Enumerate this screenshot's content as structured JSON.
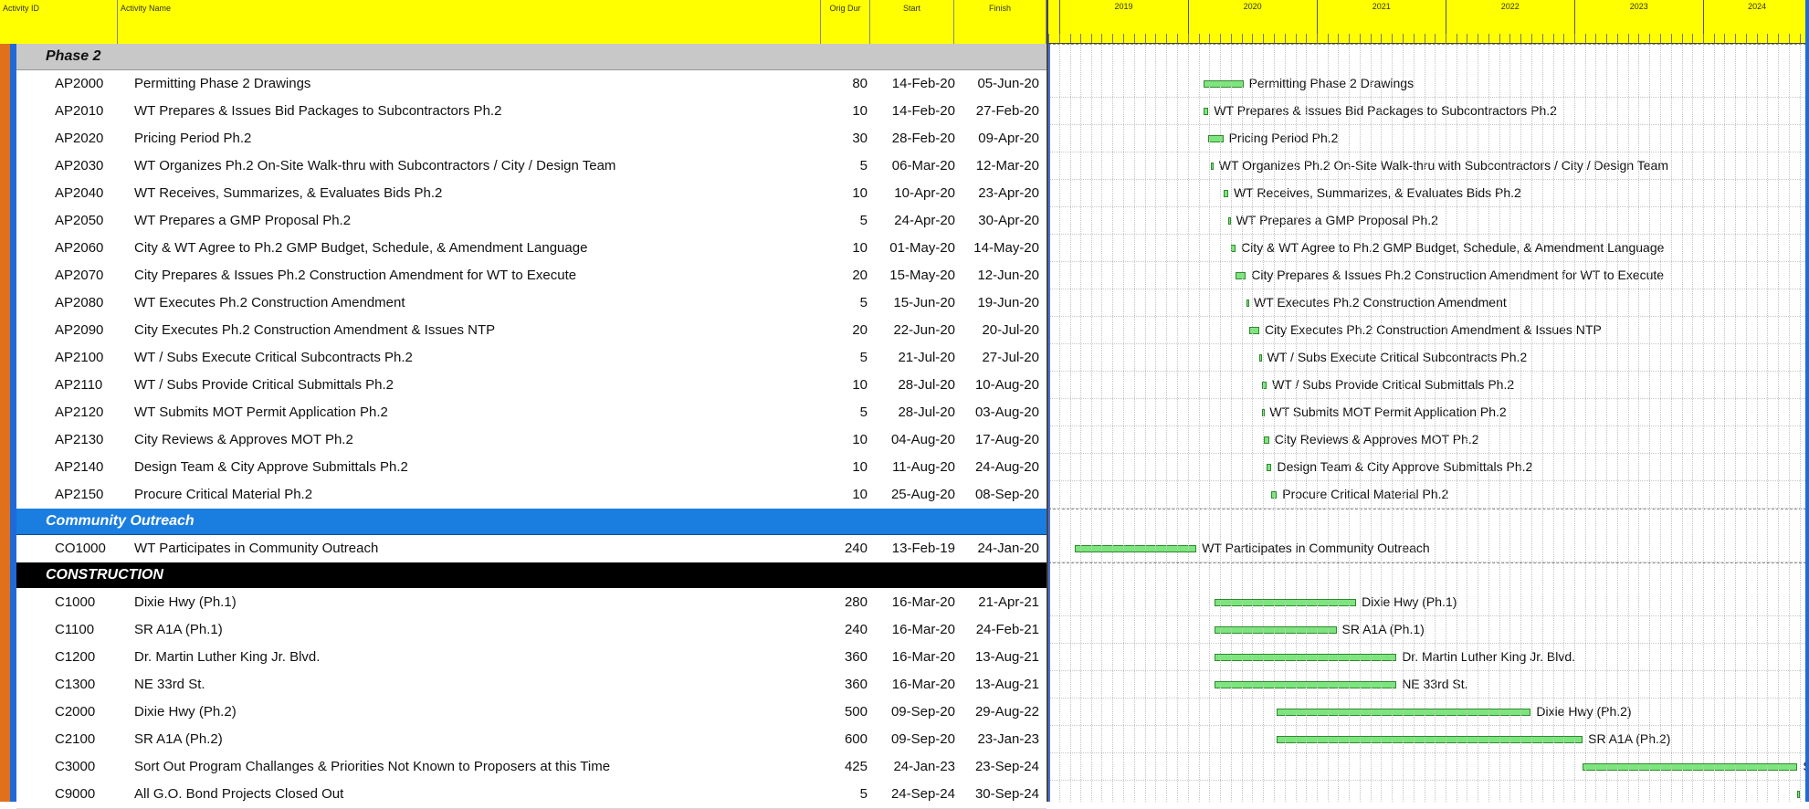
{
  "header": {
    "activity_id": "Activity ID",
    "activity_name": "Activity Name",
    "orig_dur": "Orig Dur",
    "start": "Start",
    "finish": "Finish",
    "years": [
      "2019",
      "2020",
      "2021",
      "2022",
      "2023",
      "2024"
    ]
  },
  "sections": [
    {
      "name": "Phase 2",
      "style": "gray",
      "rows": [
        {
          "id": "AP2000",
          "name": "Permitting Phase 2 Drawings",
          "dur": "80",
          "start": "14-Feb-20",
          "finish": "05-Jun-20"
        },
        {
          "id": "AP2010",
          "name": "WT Prepares & Issues Bid Packages to Subcontractors Ph.2",
          "dur": "10",
          "start": "14-Feb-20",
          "finish": "27-Feb-20"
        },
        {
          "id": "AP2020",
          "name": "Pricing Period Ph.2",
          "dur": "30",
          "start": "28-Feb-20",
          "finish": "09-Apr-20"
        },
        {
          "id": "AP2030",
          "name": "WT Organizes Ph.2 On-Site Walk-thru with Subcontractors / City / Design Team",
          "dur": "5",
          "start": "06-Mar-20",
          "finish": "12-Mar-20"
        },
        {
          "id": "AP2040",
          "name": "WT Receives, Summarizes, & Evaluates Bids Ph.2",
          "dur": "10",
          "start": "10-Apr-20",
          "finish": "23-Apr-20"
        },
        {
          "id": "AP2050",
          "name": "WT Prepares a GMP Proposal Ph.2",
          "dur": "5",
          "start": "24-Apr-20",
          "finish": "30-Apr-20"
        },
        {
          "id": "AP2060",
          "name": "City & WT Agree to Ph.2 GMP Budget, Schedule, & Amendment Language",
          "dur": "10",
          "start": "01-May-20",
          "finish": "14-May-20"
        },
        {
          "id": "AP2070",
          "name": "City Prepares & Issues Ph.2 Construction Amendment for WT to Execute",
          "dur": "20",
          "start": "15-May-20",
          "finish": "12-Jun-20"
        },
        {
          "id": "AP2080",
          "name": "WT Executes Ph.2 Construction Amendment",
          "dur": "5",
          "start": "15-Jun-20",
          "finish": "19-Jun-20"
        },
        {
          "id": "AP2090",
          "name": "City Executes Ph.2 Construction Amendment & Issues NTP",
          "dur": "20",
          "start": "22-Jun-20",
          "finish": "20-Jul-20"
        },
        {
          "id": "AP2100",
          "name": "WT / Subs Execute Critical Subcontracts Ph.2",
          "dur": "5",
          "start": "21-Jul-20",
          "finish": "27-Jul-20"
        },
        {
          "id": "AP2110",
          "name": "WT / Subs Provide Critical Submittals Ph.2",
          "dur": "10",
          "start": "28-Jul-20",
          "finish": "10-Aug-20"
        },
        {
          "id": "AP2120",
          "name": "WT Submits MOT Permit Application Ph.2",
          "dur": "5",
          "start": "28-Jul-20",
          "finish": "03-Aug-20"
        },
        {
          "id": "AP2130",
          "name": "City Reviews & Approves MOT Ph.2",
          "dur": "10",
          "start": "04-Aug-20",
          "finish": "17-Aug-20"
        },
        {
          "id": "AP2140",
          "name": "Design Team & City Approve Submittals Ph.2",
          "dur": "10",
          "start": "11-Aug-20",
          "finish": "24-Aug-20"
        },
        {
          "id": "AP2150",
          "name": "Procure Critical Material Ph.2",
          "dur": "10",
          "start": "25-Aug-20",
          "finish": "08-Sep-20"
        }
      ]
    },
    {
      "name": "Community Outreach",
      "style": "blue",
      "rows": [
        {
          "id": "CO1000",
          "name": "WT Participates in Community Outreach",
          "dur": "240",
          "start": "13-Feb-19",
          "finish": "24-Jan-20"
        }
      ]
    },
    {
      "name": "CONSTRUCTION",
      "style": "black",
      "rows": [
        {
          "id": "C1000",
          "name": "Dixie Hwy (Ph.1)",
          "dur": "280",
          "start": "16-Mar-20",
          "finish": "21-Apr-21"
        },
        {
          "id": "C1100",
          "name": "SR A1A (Ph.1)",
          "dur": "240",
          "start": "16-Mar-20",
          "finish": "24-Feb-21"
        },
        {
          "id": "C1200",
          "name": "Dr. Martin Luther King Jr. Blvd.",
          "dur": "360",
          "start": "16-Mar-20",
          "finish": "13-Aug-21"
        },
        {
          "id": "C1300",
          "name": "NE 33rd St.",
          "dur": "360",
          "start": "16-Mar-20",
          "finish": "13-Aug-21"
        },
        {
          "id": "C2000",
          "name": "Dixie Hwy (Ph.2)",
          "dur": "500",
          "start": "09-Sep-20",
          "finish": "29-Aug-22"
        },
        {
          "id": "C2100",
          "name": "SR A1A (Ph.2)",
          "dur": "600",
          "start": "09-Sep-20",
          "finish": "23-Jan-23"
        },
        {
          "id": "C3000",
          "name": "Sort Out Program Challanges & Priorities Not Known to Proposers at this Time",
          "dur": "425",
          "start": "24-Jan-23",
          "finish": "23-Sep-24"
        },
        {
          "id": "C9000",
          "name": "All G.O. Bond Projects Closed Out",
          "dur": "5",
          "start": "24-Sep-24",
          "finish": "30-Sep-24"
        }
      ]
    }
  ],
  "colors": {
    "header": "#ffff00",
    "bar_fill": "#7de57d",
    "bar_border": "#2f8a2f",
    "section_gray": "#c8c8c8",
    "section_blue": "#1a7de0",
    "section_black": "#000000"
  }
}
